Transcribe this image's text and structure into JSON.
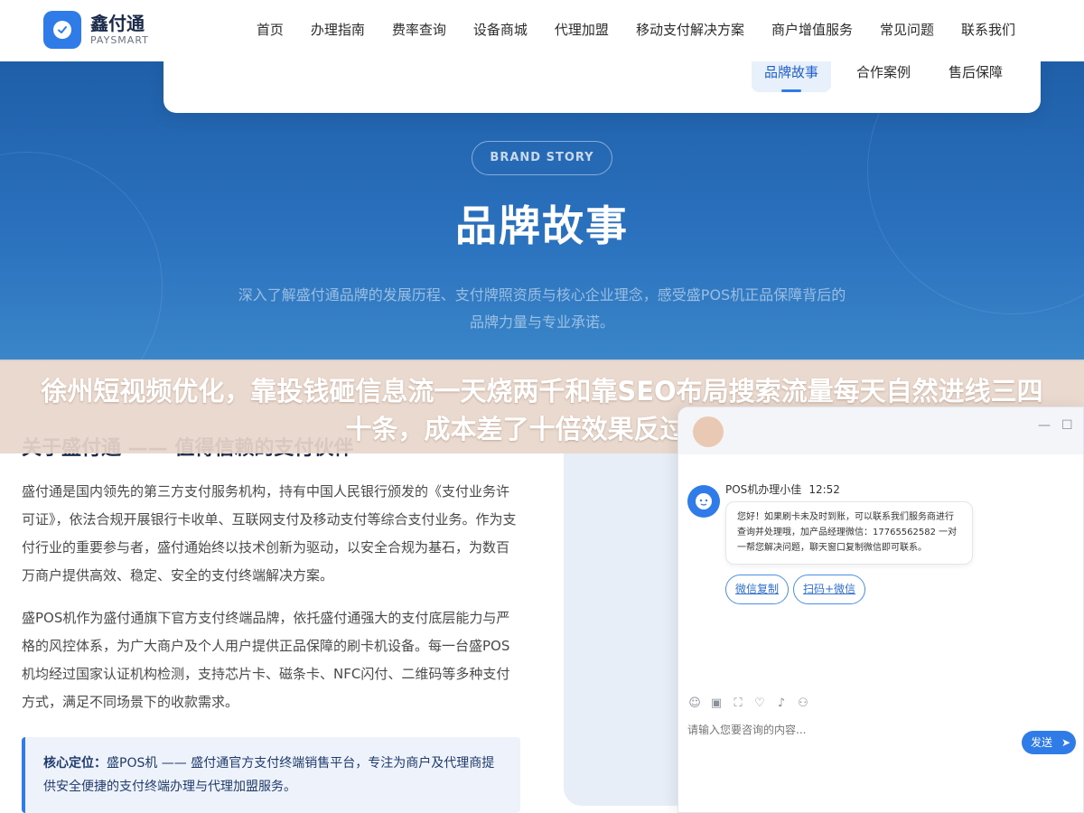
{
  "header": {
    "logo_name": "鑫付通",
    "logo_sub": "PAYSMART",
    "nav": [
      "首页",
      "办理指南",
      "费率查询",
      "设备商城",
      "代理加盟",
      "移动支付解决方案",
      "商户增值服务",
      "常见问题",
      "联系我们"
    ],
    "sub_nav": [
      "品牌故事",
      "合作案例",
      "售后保障"
    ],
    "active_sub": "品牌故事"
  },
  "hero": {
    "badge": "BRAND STORY",
    "title": "品牌故事",
    "desc": "深入了解盛付通品牌的发展历程、支付牌照资质与核心企业理念，感受盛POS机正品保障背后的品牌力量与专业承诺。"
  },
  "banner": {
    "text": "徐州短视频优化，靠投钱砸信息流一天烧两千和靠SEO布局搜索流量每天自然进线三四十条，成本差了十倍效果反过来了"
  },
  "content": {
    "section_title": "关于盛付通 —— 值得信赖的支付伙伴",
    "para1": "盛付通是国内领先的第三方支付服务机构，持有中国人民银行颁发的《支付业务许可证》，依法合规开展银行卡收单、互联网支付及移动支付等综合支付业务。作为支付行业的重要参与者，盛付通始终以技术创新为驱动，以安全合规为基石，为数百万商户提供高效、稳定、安全的支付终端解决方案。",
    "para2": "盛POS机作为盛付通旗下官方支付终端品牌，依托盛付通强大的支付底层能力与严格的风控体系，为广大商户及个人用户提供正品保障的刷卡机设备。每一台盛POS机均经过国家认证机构检测，支持芯片卡、磁条卡、NFC闪付、二维码等多种支付方式，满足不同场景下的收款需求。",
    "note_label": "核心定位：",
    "note_text": "盛POS机 —— 盛付通官方支付终端销售平台，专注为商户及代理商提供安全便捷的支付终端办理与代理加盟服务。"
  },
  "chat": {
    "agent_name": "POS机办理小佳",
    "time": "12:52",
    "message": "您好！如果刷卡未及时到账，可以联系我们服务商进行查询并处理哦，加产品经理微信：17765562582 一对一帮您解决问题，聊天窗口复制微信即可联系。",
    "btn_copy": "微信复制",
    "btn_scan": "扫码+微信",
    "input_placeholder": "请输入您要咨询的内容...",
    "send": "发送",
    "minimize": "—",
    "maximize": "☐"
  },
  "colors": {
    "brand_blue": "#2f7be8",
    "hero_blue": "#2a70bd",
    "banner_bg": "#e8d6ca"
  }
}
